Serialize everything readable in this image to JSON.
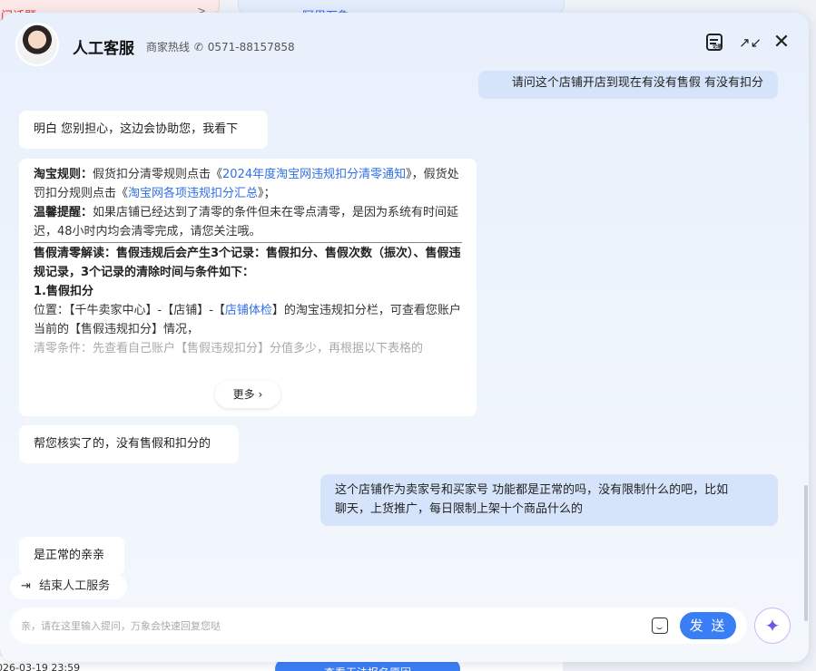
{
  "background": {
    "left_tab_text": "门话题",
    "left_tab_chevron": ">",
    "mid_tab_text": "阿里万象",
    "time_text": "026-03-19 23:59",
    "bottom_button": "查看无法报名原因"
  },
  "header": {
    "title": "人工客服",
    "hotline_label": "商家热线",
    "hotline_number": "0571-88157858",
    "notes_tiny": "记录",
    "minimize_glyph": "↗↙",
    "close_glyph": "✕"
  },
  "messages": {
    "m1_user": "请问这个店铺开店到现在有没有售假 有没有扣分",
    "m2_agent": "明白 您别担心，这边会协助您，我看下",
    "m3_rich": {
      "p1_bold": "淘宝规则：",
      "p1_a": "假货扣分清零规则点击《",
      "p1_link1": "2024年度淘宝网违规扣分清零通知",
      "p1_b": "》，",
      "p1_c": "假货处罚扣分规则点击《",
      "p1_link2": "淘宝网各项违规扣分汇总",
      "p1_d": "》；",
      "p2_bold": "温馨提醒：",
      "p2_text": "如果店铺已经达到了清零的条件但未在零点清零，是因为系统有时间延迟，48小时内均会清零完成，请您关注哦。",
      "p3_bold": "售假清零解读：售假违规后会产生3个记录：售假扣分、售假次数（振次）、售假违规记录，3个记录的清除时间与条件如下：",
      "p4_bold": "1.售假扣分",
      "p5_a": "位置：【千牛卖家中心】-【店铺】-【",
      "p5_link": "店铺体检",
      "p5_b": "】的淘宝违规扣分栏，可查看您账户当前的【售假违规扣分】情况，",
      "p6_fade": "清零条件：先查看自己账户【售假违规扣分】分值多少，再根据以下表格的",
      "more_label": "更多",
      "more_chevron": "›"
    },
    "m4_agent": "帮您核实了的，没有售假和扣分的",
    "m5_user_line1": "这个店铺作为卖家号和买家号 功能都是正常的吗，没有限制什么的吧，比如",
    "m5_user_line2": "聊天，上货推广，每日限制上架十个商品什么的",
    "m6_agent": "是正常的亲亲"
  },
  "footer": {
    "end_service": "结束人工服务",
    "input_placeholder": "亲，请在这里输入提问，万象会快速回复您哒",
    "send": "发 送",
    "ai_glyph": "✦"
  }
}
